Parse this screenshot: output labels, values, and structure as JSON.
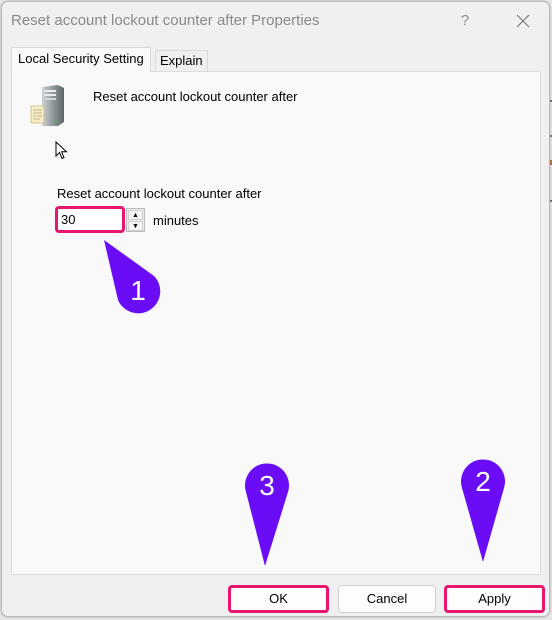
{
  "window": {
    "title": "Reset account lockout counter after Properties",
    "help_label": "?",
    "close_icon": "close-icon"
  },
  "tabs": [
    {
      "label": "Local Security Setting",
      "active": true
    },
    {
      "label": "Explain",
      "active": false
    }
  ],
  "panel": {
    "policy_icon": "server-policy-icon",
    "policy_title": "Reset account lockout counter after",
    "field_label": "Reset account lockout counter after",
    "field_value": "30",
    "unit_label": "minutes",
    "spin_up_glyph": "▲",
    "spin_down_glyph": "▼"
  },
  "buttons": {
    "ok": "OK",
    "cancel": "Cancel",
    "apply": "Apply"
  },
  "annotations": {
    "color": "#6a0cf5",
    "highlight_color": "#e8166e",
    "markers": [
      {
        "number": "1",
        "target": "minutes-input"
      },
      {
        "number": "2",
        "target": "apply-button"
      },
      {
        "number": "3",
        "target": "ok-button"
      }
    ]
  }
}
